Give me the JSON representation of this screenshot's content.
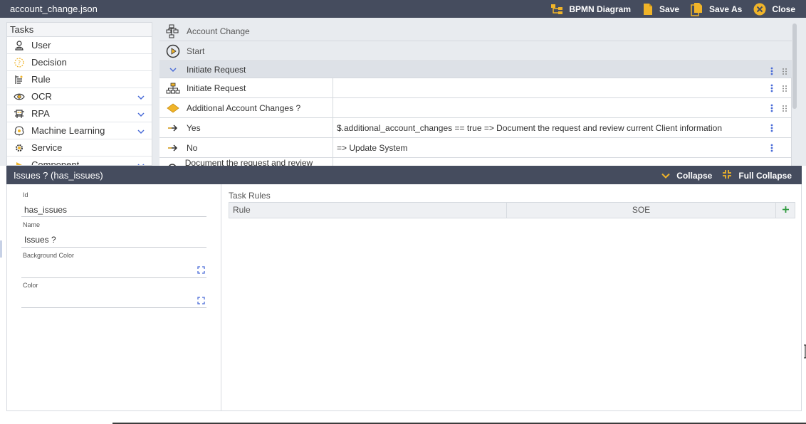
{
  "window": {
    "title": "account_change.json"
  },
  "toolbar": {
    "bpmn_label": "BPMN Diagram",
    "save_label": "Save",
    "save_as_label": "Save As",
    "close_label": "Close",
    "accent_color": "#f0b429"
  },
  "tasks_panel": {
    "title": "Tasks",
    "items": [
      {
        "label": "User",
        "icon": "user-icon",
        "expandable": false
      },
      {
        "label": "Decision",
        "icon": "decision-icon",
        "expandable": false
      },
      {
        "label": "Rule",
        "icon": "rule-icon",
        "expandable": false
      },
      {
        "label": "OCR",
        "icon": "eye-icon",
        "expandable": true
      },
      {
        "label": "RPA",
        "icon": "robot-icon",
        "expandable": true
      },
      {
        "label": "Machine Learning",
        "icon": "brain-icon",
        "expandable": true
      },
      {
        "label": "Service",
        "icon": "gear-service-icon",
        "expandable": false
      },
      {
        "label": "Component",
        "icon": "component-icon",
        "expandable": true
      }
    ]
  },
  "flow": {
    "process_name": "Account Change",
    "start_label": "Start",
    "group_label": "Initiate Request",
    "rows": [
      {
        "label": "Initiate Request",
        "detail": "",
        "icon": "hierarchy-icon",
        "grip": true
      },
      {
        "label": "Additional Account Changes ?",
        "detail": "",
        "icon": "diamond-icon",
        "grip": true
      },
      {
        "label": "Yes",
        "detail": "$.additional_account_changes == true => Document the request and review current Client information",
        "icon": "arrow-right-icon",
        "grip": false
      },
      {
        "label": "No",
        "detail": "=> Update System",
        "icon": "arrow-right-icon",
        "grip": false
      },
      {
        "label": "Document the request and review current",
        "detail": "",
        "icon": "task-icon",
        "grip": false
      }
    ]
  },
  "details": {
    "title": "Issues ? (has_issues)",
    "collapse_label": "Collapse",
    "full_collapse_label": "Full Collapse",
    "fields": {
      "id_label": "Id",
      "id_value": "has_issues",
      "name_label": "Name",
      "name_value": "Issues ?",
      "bg_color_label": "Background Color",
      "color_label": "Color"
    },
    "task_rules": {
      "title": "Task Rules",
      "col_rule": "Rule",
      "col_soe": "SOE"
    }
  }
}
